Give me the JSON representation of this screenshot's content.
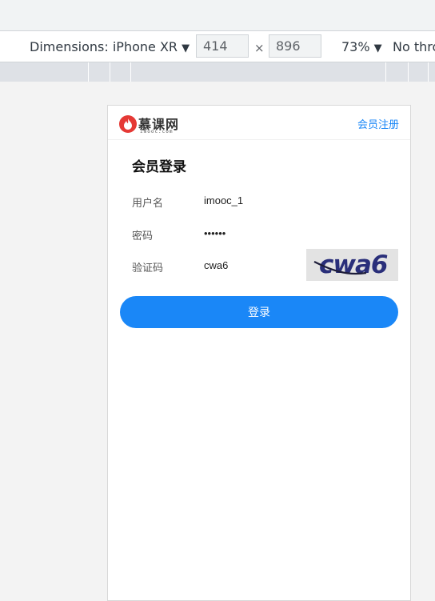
{
  "devtools": {
    "dimensions_label": "Dimensions: iPhone XR",
    "dropdown_caret": "▼",
    "width_value": "414",
    "height_value": "896",
    "times_sign": "×",
    "zoom_label": "73%",
    "throttle_label": "No thro"
  },
  "site": {
    "logo_text": "慕课网",
    "logo_sub": "imooc.com",
    "register_link": "会员注册",
    "accent_color": "#1a87f7"
  },
  "form": {
    "title": "会员登录",
    "username_label": "用户名",
    "username_value": "imooc_1",
    "password_label": "密码",
    "password_value": "••••••",
    "captcha_label": "验证码",
    "captcha_value": "cwa6",
    "captcha_image_text": "cwa6",
    "submit_label": "登录"
  }
}
